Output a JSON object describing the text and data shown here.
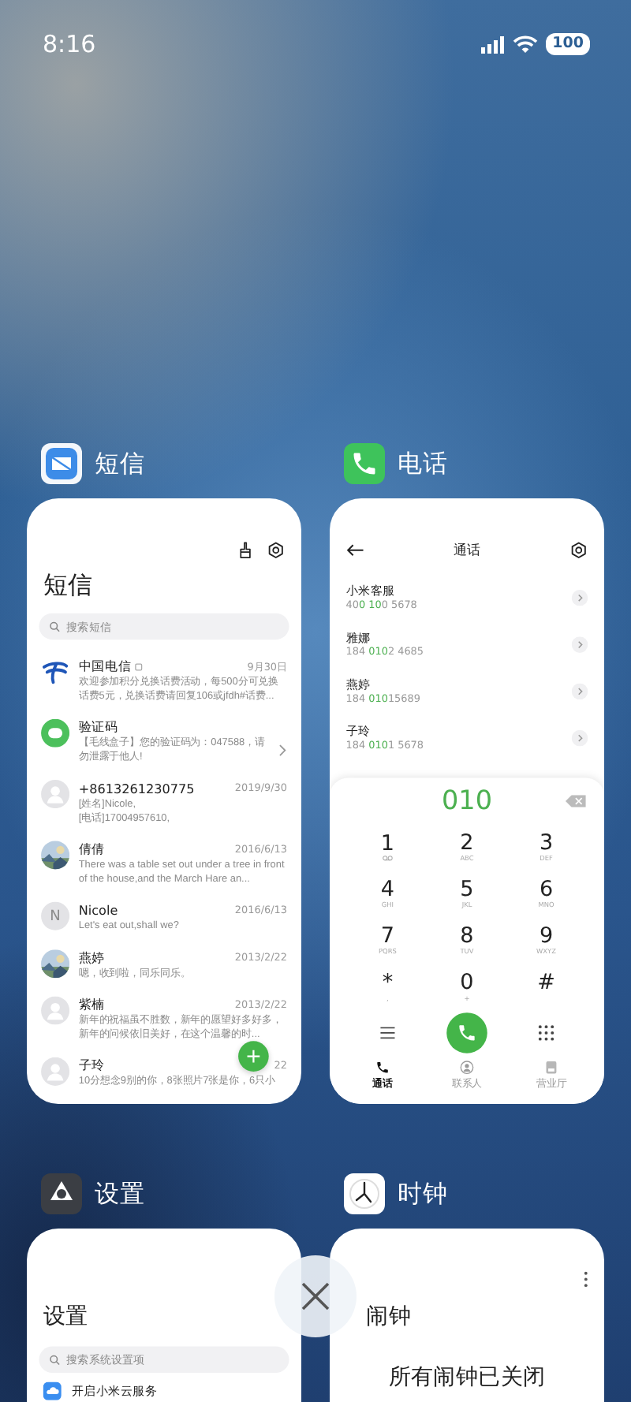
{
  "status_bar": {
    "time": "8:16",
    "battery": "100"
  },
  "apps": [
    {
      "kind": "messages",
      "name": "短信",
      "screen": {
        "title": "短信",
        "search": {
          "placeholder": "搜索短信"
        },
        "threads": [
          {
            "kind": "telecom",
            "name": "中国电信",
            "flagged": true,
            "date": "9月30日",
            "preview": "欢迎参加积分兑换话费活动，每500分可兑换话费5元，兑换话费请回复106或jfdh#话费...",
            "chevron": false
          },
          {
            "kind": "chat",
            "name": "验证码",
            "flagged": false,
            "preview": "【毛线盒子】您的验证码为：047588，请勿泄露于他人!",
            "chevron": true
          },
          {
            "kind": "person",
            "name": "+8613261230775",
            "flagged": false,
            "date": "2019/9/30",
            "preview": "[姓名]Nicole,\n[电话]17004957610,",
            "chevron": false
          },
          {
            "kind": "picture",
            "name": "倩倩",
            "flagged": false,
            "date": "2016/6/13",
            "preview": "There was a table set out under a tree in front of the house,and the March Hare an...",
            "chevron": false
          },
          {
            "kind": "letter",
            "avatar_text": "N",
            "name": "Nicole",
            "flagged": false,
            "date": "2016/6/13",
            "preview": "Let's eat out,shall we?",
            "chevron": false
          },
          {
            "kind": "picture",
            "name": "燕婷",
            "flagged": false,
            "date": "2013/2/22",
            "preview": "嗯，收到啦，同乐同乐。",
            "chevron": false
          },
          {
            "kind": "person",
            "name": "紫楠",
            "flagged": false,
            "date": "2013/2/22",
            "preview": "新年的祝福虽不胜数，新年的愿望好多好多，新年的问候依旧美好，在这个温馨的时...",
            "chevron": false
          },
          {
            "kind": "person",
            "name": "子玲",
            "flagged": false,
            "date": "22",
            "preview": "10分想念9别的你，8张照片7张是你，6只小",
            "chevron": false
          }
        ]
      }
    },
    {
      "kind": "phone",
      "name": "电话",
      "screen": {
        "title": "通话",
        "contacts": [
          {
            "name": "小米客服",
            "number": [
              {
                "text": "40",
                "match": false
              },
              {
                "text": "0 10",
                "match": true
              },
              {
                "text": "0 5678",
                "match": false
              }
            ]
          },
          {
            "name": "雅娜",
            "number": [
              {
                "text": "184 ",
                "match": false
              },
              {
                "text": "010",
                "match": true
              },
              {
                "text": "2 4685",
                "match": false
              }
            ]
          },
          {
            "name": "燕婷",
            "number": [
              {
                "text": "184 ",
                "match": false
              },
              {
                "text": "010",
                "match": true
              },
              {
                "text": "15689",
                "match": false
              }
            ]
          },
          {
            "name": "子玲",
            "number": [
              {
                "text": "184 ",
                "match": false
              },
              {
                "text": "010",
                "match": true
              },
              {
                "text": "1 5678",
                "match": false
              }
            ]
          }
        ],
        "dialer": {
          "input": "010",
          "keys": [
            {
              "digit": "1",
              "kind": "voicemail"
            },
            {
              "digit": "2",
              "kind": "letters",
              "letters": "ABC"
            },
            {
              "digit": "3",
              "kind": "letters",
              "letters": "DEF"
            },
            {
              "digit": "4",
              "kind": "letters",
              "letters": "GHI"
            },
            {
              "digit": "5",
              "kind": "letters",
              "letters": "JKL"
            },
            {
              "digit": "6",
              "kind": "letters",
              "letters": "MNO"
            },
            {
              "digit": "7",
              "kind": "letters",
              "letters": "PQRS"
            },
            {
              "digit": "8",
              "kind": "letters",
              "letters": "TUV"
            },
            {
              "digit": "9",
              "kind": "letters",
              "letters": "WXYZ"
            },
            {
              "digit": "*",
              "kind": "letters",
              "letters": ","
            },
            {
              "digit": "0",
              "kind": "letters",
              "letters": "+"
            },
            {
              "digit": "#",
              "kind": "plain"
            }
          ]
        },
        "tabs": [
          {
            "kind": "calls",
            "label": "通话",
            "selected": true
          },
          {
            "kind": "contacts",
            "label": "联系人",
            "selected": false
          },
          {
            "kind": "store",
            "label": "营业厅",
            "selected": false
          }
        ]
      }
    },
    {
      "kind": "settings",
      "name": "设置",
      "screen": {
        "title": "设置",
        "search": {
          "placeholder": "搜索系统设置项"
        },
        "items": [
          {
            "label": "开启小米云服务"
          }
        ]
      }
    },
    {
      "kind": "clock",
      "name": "时钟",
      "screen": {
        "title": "闹钟",
        "empty_message": "所有闹钟已关闭"
      }
    }
  ]
}
